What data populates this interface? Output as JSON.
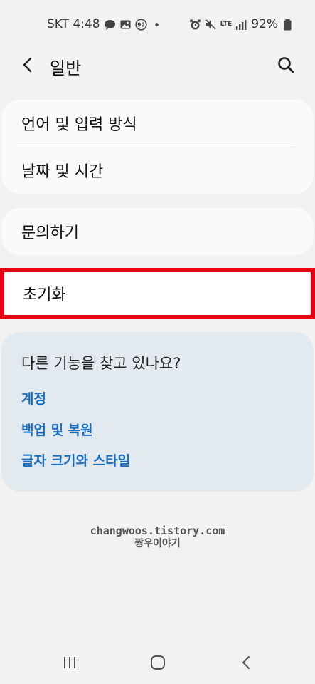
{
  "status_bar": {
    "carrier_time": "SKT 4:48",
    "battery": "92%",
    "network": "LTE",
    "icons": [
      "talk-icon",
      "gallery-icon",
      "notification-92-icon",
      "dot-icon",
      "alarm-icon",
      "mute-icon",
      "signal-icon",
      "battery-icon"
    ]
  },
  "header": {
    "title": "일반",
    "back_icon": "chevron-left-icon",
    "search_icon": "search-icon"
  },
  "menu": {
    "group1": [
      "언어 및 입력 방식",
      "날짜 및 시간"
    ],
    "group2": [
      "문의하기"
    ],
    "reset": "초기화"
  },
  "suggestion": {
    "title": "다른 기능을 찾고 있나요?",
    "links": [
      "계정",
      "백업 및 복원",
      "글자 크기와 스타일"
    ]
  },
  "watermark": {
    "line1": "changwoos.tistory.com",
    "line2": "짱우이야기"
  },
  "nav_bar": {
    "icons": [
      "recents-icon",
      "home-icon",
      "back-icon"
    ]
  },
  "colors": {
    "background": "#f2f2f2",
    "card": "#fafafa",
    "highlight_border": "#e60012",
    "suggestion_bg": "#e2e9ef",
    "link": "#1a6ec2"
  }
}
